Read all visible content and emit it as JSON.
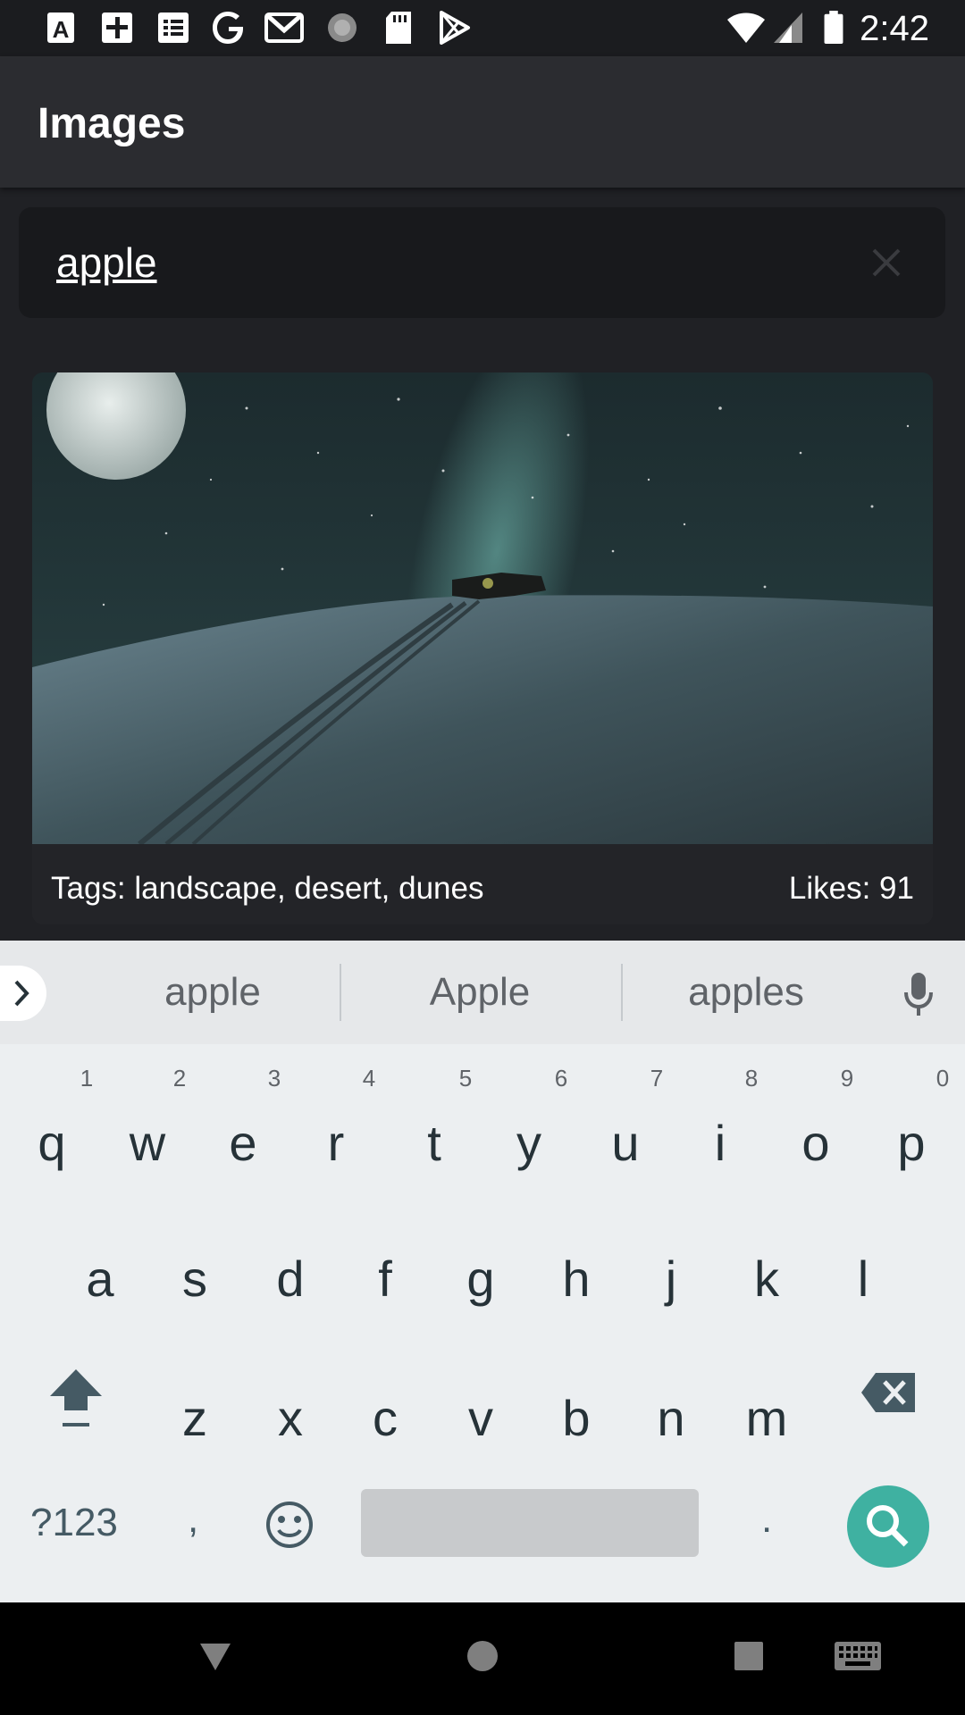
{
  "status_bar": {
    "time": "2:42",
    "left_icons": [
      "font-icon",
      "add-box-icon",
      "list-icon",
      "google-icon",
      "gmail-icon",
      "sync-icon",
      "sd-card-icon",
      "play-store-icon"
    ],
    "right_icons": [
      "wifi-icon",
      "signal-icon",
      "battery-icon"
    ]
  },
  "app_bar": {
    "title": "Images"
  },
  "search": {
    "value": "apple"
  },
  "results": [
    {
      "tags": "Tags: landscape, desert, dunes",
      "likes": "Likes: 91"
    }
  ],
  "suggestions": [
    "apple",
    "Apple",
    "apples"
  ],
  "keyboard": {
    "row1": [
      {
        "key": "q",
        "hint": "1"
      },
      {
        "key": "w",
        "hint": "2"
      },
      {
        "key": "e",
        "hint": "3"
      },
      {
        "key": "r",
        "hint": "4"
      },
      {
        "key": "t",
        "hint": "5"
      },
      {
        "key": "y",
        "hint": "6"
      },
      {
        "key": "u",
        "hint": "7"
      },
      {
        "key": "i",
        "hint": "8"
      },
      {
        "key": "o",
        "hint": "9"
      },
      {
        "key": "p",
        "hint": "0"
      }
    ],
    "row2": [
      "a",
      "s",
      "d",
      "f",
      "g",
      "h",
      "j",
      "k",
      "l"
    ],
    "row3": [
      "z",
      "x",
      "c",
      "v",
      "b",
      "n",
      "m"
    ],
    "symbols_key": "?123",
    "comma_key": ",",
    "period_key": "."
  },
  "colors": {
    "background": "#202125",
    "app_bar": "#2b2c30",
    "search_box": "#18191c",
    "accent": "#3fb1a1",
    "keyboard": "#eceff1"
  }
}
